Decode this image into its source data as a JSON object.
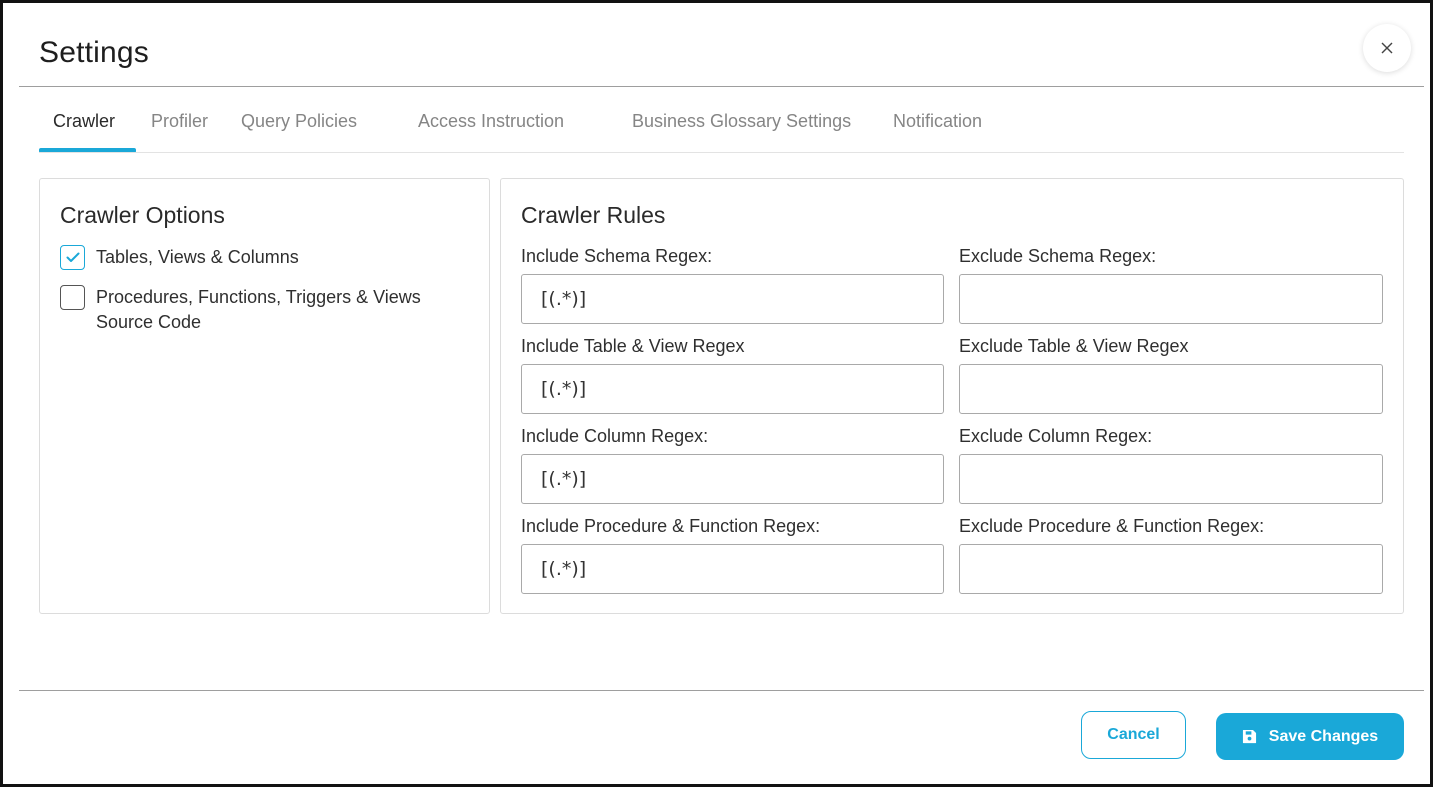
{
  "header": {
    "title": "Settings",
    "close_icon": "close-icon"
  },
  "tabs": [
    {
      "label": "Crawler",
      "active": true
    },
    {
      "label": "Profiler",
      "active": false
    },
    {
      "label": "Query Policies",
      "active": false
    },
    {
      "label": "Access Instruction",
      "active": false
    },
    {
      "label": "Business Glossary Settings",
      "active": false
    },
    {
      "label": "Notification",
      "active": false
    }
  ],
  "crawler_options": {
    "title": "Crawler Options",
    "options": [
      {
        "label": "Tables, Views & Columns",
        "checked": true
      },
      {
        "label": "Procedures, Functions, Triggers & Views Source Code",
        "checked": false
      }
    ]
  },
  "crawler_rules": {
    "title": "Crawler Rules",
    "fields": {
      "include_schema": {
        "label": "Include Schema Regex:",
        "value": "[(.*)]"
      },
      "exclude_schema": {
        "label": "Exclude Schema Regex:",
        "value": ""
      },
      "include_table_view": {
        "label": "Include Table & View Regex",
        "value": "[(.*)]"
      },
      "exclude_table_view": {
        "label": "Exclude Table & View Regex",
        "value": ""
      },
      "include_column": {
        "label": "Include Column Regex:",
        "value": "[(.*)]"
      },
      "exclude_column": {
        "label": "Exclude Column Regex:",
        "value": ""
      },
      "include_procedure_function": {
        "label": "Include Procedure & Function Regex:",
        "value": "[(.*)]"
      },
      "exclude_procedure_function": {
        "label": "Exclude Procedure & Function Regex:",
        "value": ""
      }
    }
  },
  "footer": {
    "cancel_label": "Cancel",
    "save_label": "Save Changes",
    "save_icon": "save-icon"
  },
  "colors": {
    "accent": "#1aa8d8",
    "border": "#a9a9a9",
    "muted_text": "#858585"
  }
}
